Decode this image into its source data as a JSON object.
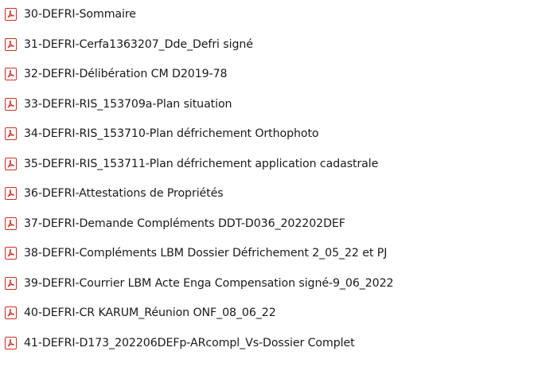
{
  "file_list": {
    "icon": "pdf-file-icon",
    "icon_color": "#cf2d23",
    "items": [
      {
        "name": "30-DEFRI-Sommaire"
      },
      {
        "name": "31-DEFRI-Cerfa1363207_Dde_Defri signé"
      },
      {
        "name": "32-DEFRI-Délibération CM D2019-78"
      },
      {
        "name": "33-DEFRI-RIS_153709a-Plan situation"
      },
      {
        "name": "34-DEFRI-RIS_153710-Plan défrichement Orthophoto"
      },
      {
        "name": "35-DEFRI-RIS_153711-Plan défrichement application cadastrale"
      },
      {
        "name": "36-DEFRI-Attestations de Propriétés"
      },
      {
        "name": "37-DEFRI-Demande Compléments DDT-D036_202202DEF"
      },
      {
        "name": "38-DEFRI-Compléments LBM Dossier Défrichement 2_05_22 et PJ"
      },
      {
        "name": "39-DEFRI-Courrier LBM Acte Enga Compensation signé-9_06_2022"
      },
      {
        "name": "40-DEFRI-CR KARUM_Réunion ONF_08_06_22"
      },
      {
        "name": "41-DEFRI-D173_202206DEFp-ARcompl_Vs-Dossier Complet"
      }
    ]
  }
}
